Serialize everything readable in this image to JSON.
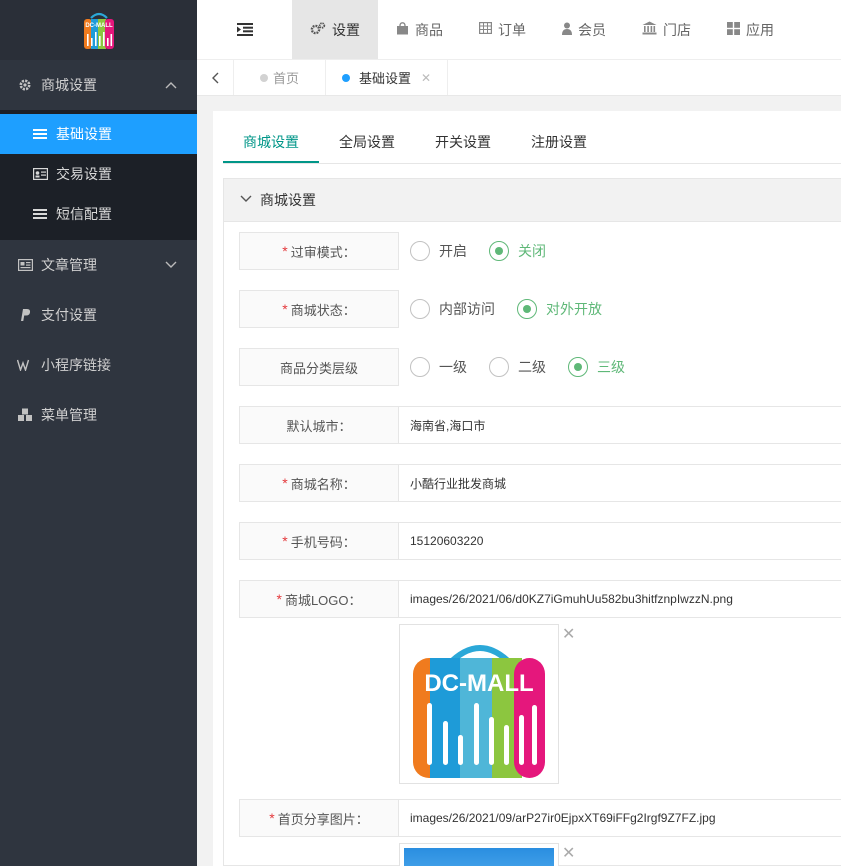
{
  "sidebar": {
    "logo_text": "DC-MALL",
    "groups": [
      {
        "label": "商城设置",
        "icon": "gear-icon",
        "expanded": true,
        "items": [
          {
            "label": "基础设置",
            "icon": "list-icon",
            "active": true
          },
          {
            "label": "交易设置",
            "icon": "id-card-icon",
            "active": false
          },
          {
            "label": "短信配置",
            "icon": "list-icon",
            "active": false
          }
        ]
      },
      {
        "label": "文章管理",
        "icon": "newspaper-icon",
        "expanded": false
      },
      {
        "label": "支付设置",
        "icon": "paypal-icon"
      },
      {
        "label": "小程序链接",
        "icon": "weixin-icon"
      },
      {
        "label": "菜单管理",
        "icon": "cubes-icon"
      }
    ]
  },
  "topnav": {
    "tabs": [
      {
        "label": "设置",
        "icon": "gears-icon",
        "active": true
      },
      {
        "label": "商品",
        "icon": "shopping-bag-icon",
        "active": false
      },
      {
        "label": "订单",
        "icon": "table-icon",
        "active": false
      },
      {
        "label": "会员",
        "icon": "user-icon",
        "active": false
      },
      {
        "label": "门店",
        "icon": "bank-icon",
        "active": false
      },
      {
        "label": "应用",
        "icon": "th-large-icon",
        "active": false
      }
    ]
  },
  "pagetabs": {
    "home": "首页",
    "current": "基础设置"
  },
  "subtabs": [
    "商城设置",
    "全局设置",
    "开关设置",
    "注册设置"
  ],
  "panel": {
    "title": "商城设置",
    "fields": {
      "review_mode": {
        "label": "过审模式：",
        "options": [
          "开启",
          "关闭"
        ],
        "selected": "关闭"
      },
      "mall_status": {
        "label": "商城状态：",
        "options": [
          "内部访问",
          "对外开放"
        ],
        "selected": "对外开放"
      },
      "category_level": {
        "label": "商品分类层级",
        "options": [
          "一级",
          "二级",
          "三级"
        ],
        "selected": "三级"
      },
      "default_city": {
        "label": "默认城市：",
        "value": "海南省,海口市"
      },
      "mall_name": {
        "label": "商城名称：",
        "value": "小酷行业批发商城"
      },
      "phone": {
        "label": "手机号码：",
        "value": "15120603220"
      },
      "logo": {
        "label": "商城LOGO：",
        "value": "images/26/2021/06/d0KZ7iGmuhUu582bu3hitfznpIwzzN.png",
        "image_text": "DC-MALL"
      },
      "share_image": {
        "label": "首页分享图片：",
        "value": "images/26/2021/09/arP27ir0EjpxXT69iFFg2Irgf9Z7FZ.jpg"
      }
    }
  },
  "colors": {
    "sidebar_bg": "#2f353f",
    "active_blue": "#1e9fff",
    "tab_green": "#009688",
    "radio_green": "#5fb878",
    "required_red": "#e4393c"
  }
}
